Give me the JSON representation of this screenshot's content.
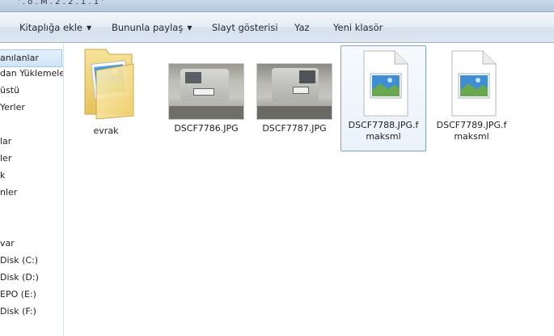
{
  "window": {
    "title_fragment": "' . o . M . 2 . 2 . 1 . 1 '"
  },
  "toolbar": {
    "library_add": "Kitaplığa ekle",
    "share_with": "Bununla paylaş",
    "slideshow": "Slayt gösterisi",
    "burn": "Yaz",
    "new_folder": "Yeni klasör"
  },
  "nav": {
    "items": [
      "anılanlar",
      "dan Yüklemeler",
      "üstü",
      "Yerler",
      "",
      "lar",
      "ler",
      "k",
      "nler",
      "",
      "",
      "var",
      "Disk (C:)",
      "Disk (D:)",
      "EPO (E:)",
      "Disk (F:)"
    ]
  },
  "files": [
    {
      "name": "evrak",
      "type": "folder"
    },
    {
      "name": "DSCF7786.JPG",
      "type": "photo"
    },
    {
      "name": "DSCF7787.JPG",
      "type": "photo"
    },
    {
      "name": "DSCF7788.JPG.fmaksml",
      "type": "image-file"
    },
    {
      "name": "DSCF7789.JPG.fmaksml",
      "type": "image-file"
    }
  ],
  "colors": {
    "selection_border": "#7da2ce",
    "toolbar_text": "#1e2b3a",
    "folder_yellow": "#f4d77a"
  }
}
